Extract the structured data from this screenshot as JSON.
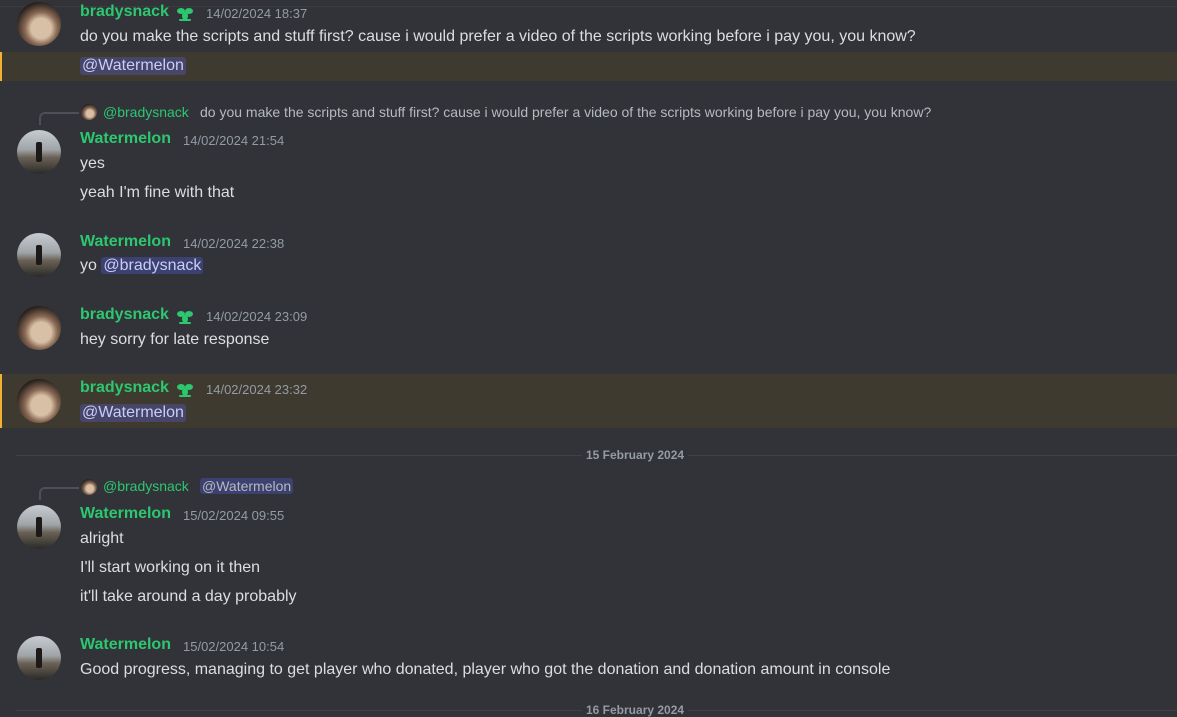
{
  "colors": {
    "background": "#313338",
    "username": "#2dc770",
    "mention_bg": "#3c4270",
    "highlight": "#3f3a2f",
    "highlight_bar": "#f0b232"
  },
  "messages": {
    "m1": {
      "author": "bradysnack",
      "timestamp": "14/02/2024 18:37",
      "lines": [
        "do you make the scripts and stuff first? cause i would prefer a video of the scripts working before i pay you, you know?"
      ],
      "mention": "@Watermelon"
    },
    "m2": {
      "reply": {
        "author": "@bradysnack",
        "text": "do you make the scripts and stuff first? cause i would prefer a video of the scripts working before i pay you, you know?"
      },
      "author": "Watermelon",
      "timestamp": "14/02/2024 21:54",
      "lines": [
        "yes",
        "yeah I'm fine with that"
      ]
    },
    "m3": {
      "author": "Watermelon",
      "timestamp": "14/02/2024 22:38",
      "prefix": "yo",
      "mention": "@bradysnack"
    },
    "m4": {
      "author": "bradysnack",
      "timestamp": "14/02/2024 23:09",
      "lines": [
        "hey sorry for late response"
      ]
    },
    "m5": {
      "author": "bradysnack",
      "timestamp": "14/02/2024 23:32",
      "mention": "@Watermelon"
    },
    "m6": {
      "reply": {
        "author": "@bradysnack",
        "mention": "@Watermelon"
      },
      "author": "Watermelon",
      "timestamp": "15/02/2024 09:55",
      "lines": [
        "alright",
        "I'll start working on it then",
        "it'll take around a day probably"
      ]
    },
    "m7": {
      "author": "Watermelon",
      "timestamp": "15/02/2024 10:54",
      "lines": [
        "Good progress, managing to get player who donated, player who got the donation and donation amount in console"
      ]
    }
  },
  "dividers": {
    "d1": "15 February 2024",
    "d2": "16 February 2024"
  },
  "icons": {
    "badge": "leaf-badge-icon"
  }
}
